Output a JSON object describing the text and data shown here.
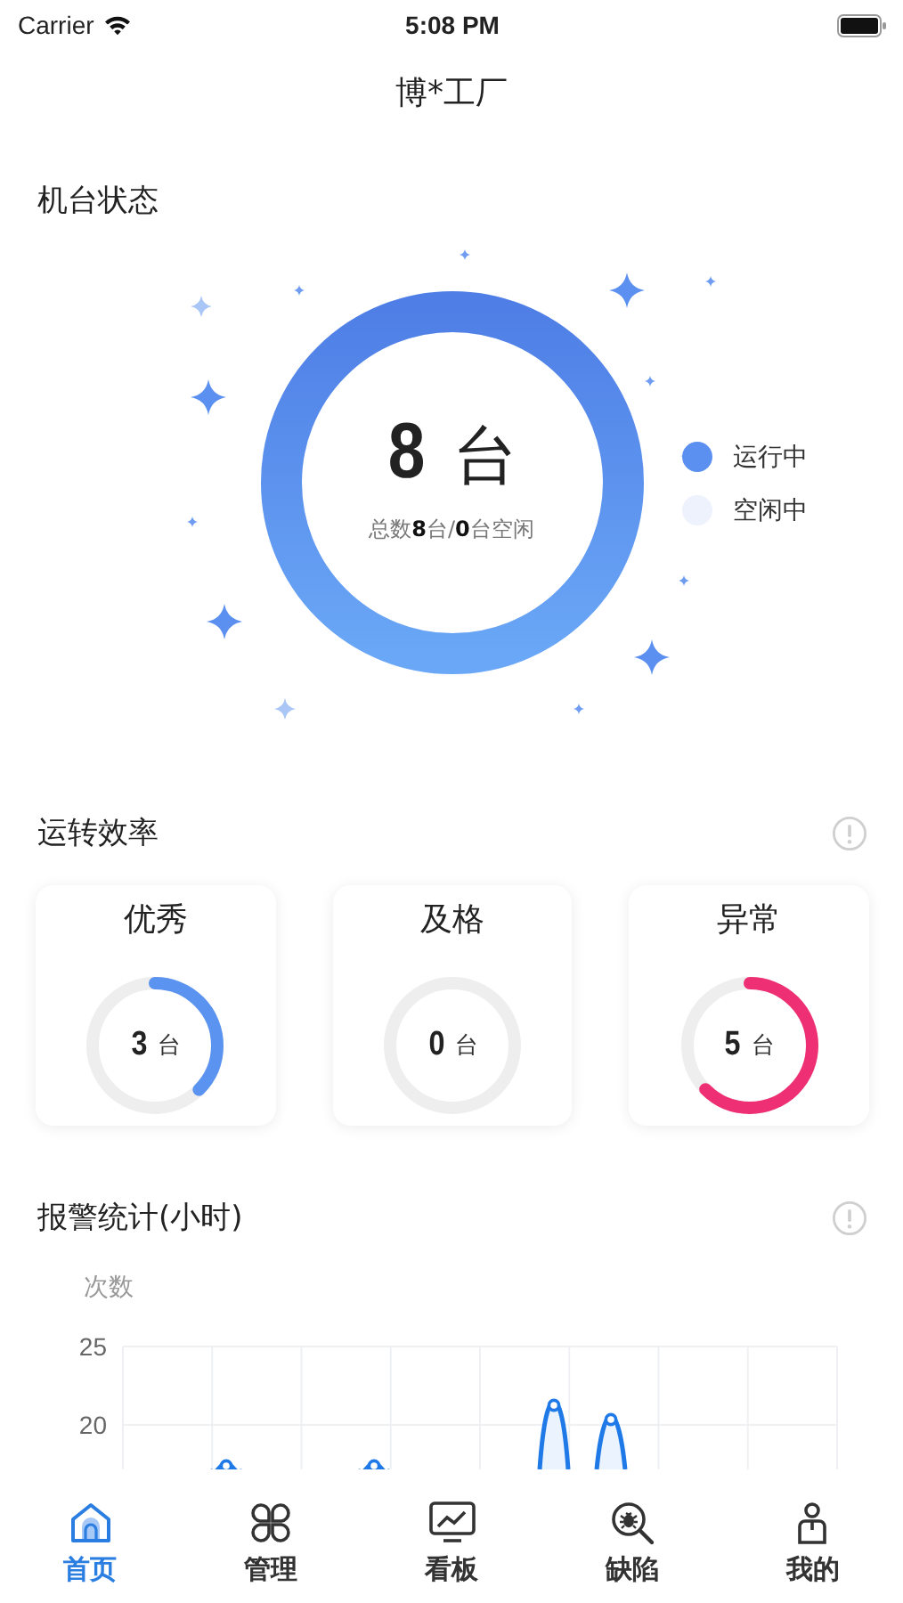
{
  "status_bar": {
    "carrier": "Carrier",
    "time": "5:08 PM"
  },
  "header": {
    "title": "博*工厂"
  },
  "machine_status": {
    "title": "机台状态",
    "count": "8",
    "unit": "台",
    "summary": "总数**8**台/**0**台空闲",
    "legend": [
      {
        "label": "运行中",
        "color": "#5b8ff0"
      },
      {
        "label": "空闲中",
        "color": "#eef2fd"
      }
    ]
  },
  "efficiency": {
    "title": "运转效率",
    "cards": [
      {
        "label": "优秀",
        "count": "3",
        "unit": "台",
        "color": "#5b93f0"
      },
      {
        "label": "及格",
        "count": "0",
        "unit": "台"
      },
      {
        "label": "异常",
        "count": "5",
        "unit": "台",
        "color": "#ee2f73"
      }
    ]
  },
  "alarms": {
    "title": "报警统计(小时)",
    "axis_title": "次数",
    "y_ticks": [
      "25",
      "20"
    ]
  },
  "tabs": [
    {
      "label": "首页",
      "selected": true
    },
    {
      "label": "管理",
      "selected": false
    },
    {
      "label": "看板",
      "selected": false
    },
    {
      "label": "缺陷",
      "selected": false
    },
    {
      "label": "我的",
      "selected": false
    }
  ]
}
